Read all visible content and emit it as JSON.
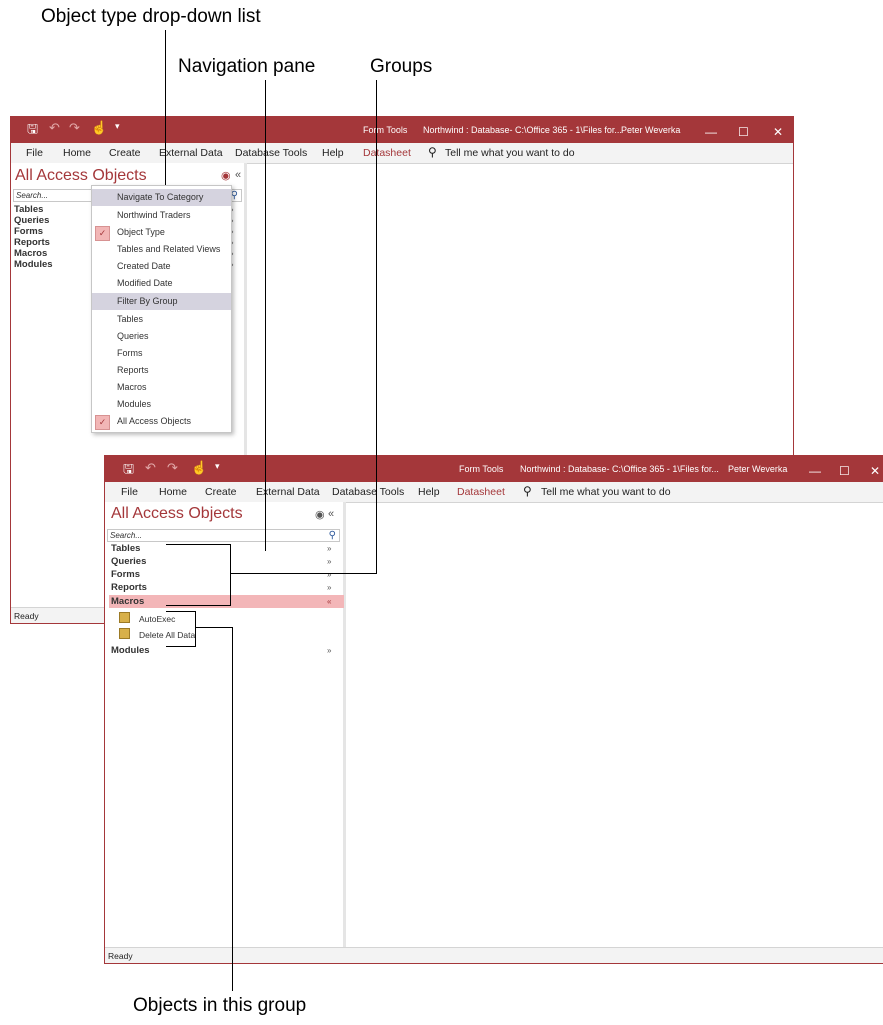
{
  "callouts": {
    "object_type": "Object type drop-down list",
    "nav_pane": "Navigation pane",
    "groups": "Groups",
    "objects": "Objects in this group"
  },
  "window": {
    "context_tab": "Form Tools",
    "title": "Northwind : Database- C:\\Office 365 - 1\\Files for...",
    "user": "Peter Weverka",
    "ribbon_tabs": [
      "File",
      "Home",
      "Create",
      "External Data",
      "Database Tools",
      "Help",
      "Datasheet"
    ],
    "tell_me": "Tell me what you want to do",
    "status": "Ready",
    "controls": {
      "minimize": "—",
      "maximize": "☐",
      "close": "✕"
    }
  },
  "nav": {
    "title": "All Access Objects",
    "search_placeholder": "Search...",
    "groups": [
      "Tables",
      "Queries",
      "Forms",
      "Reports",
      "Macros",
      "Modules"
    ],
    "macro_items": [
      "AutoExec",
      "Delete All Data"
    ]
  },
  "menu": {
    "navigate_header": "Navigate To Category",
    "categories": [
      "Northwind Traders",
      "Object Type",
      "Tables and Related Views",
      "Created Date",
      "Modified Date"
    ],
    "filter_header": "Filter By Group",
    "filters": [
      "Tables",
      "Queries",
      "Forms",
      "Reports",
      "Macros",
      "Modules",
      "All Access Objects"
    ]
  },
  "colors": {
    "accent": "#a4373a",
    "highlight": "#f3b6b8",
    "menu_header": "#d5d3df"
  },
  "icons": [
    "save-icon",
    "undo-icon",
    "redo-icon",
    "touch-mode-icon",
    "customize-qat-icon",
    "search-icon",
    "lightbulb-search-icon",
    "dropdown-circle-icon",
    "collapse-double-left-icon",
    "expand-chevron-icon",
    "collapse-chevron-icon",
    "macro-icon",
    "check-icon"
  ]
}
